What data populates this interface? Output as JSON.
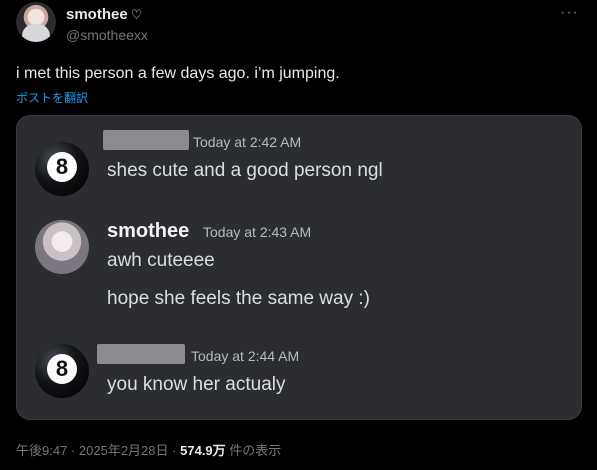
{
  "post": {
    "display_name": "smothee",
    "name_icon": "♡",
    "handle": "@smotheexx",
    "more_icon": "···",
    "text": "i met this person a few days ago. i’m jumping.",
    "translate": "ポストを翻訳"
  },
  "embed": {
    "messages": [
      {
        "author": "",
        "time": "Today at 2:42 AM",
        "lines": [
          "shes cute and a good person ngl"
        ]
      },
      {
        "author": "smothee",
        "time": "Today at 2:43 AM",
        "lines": [
          "awh cuteeee",
          "hope she feels the same way :)"
        ]
      },
      {
        "author": "",
        "time": "Today at 2:44 AM",
        "lines": [
          "you know her actualy"
        ]
      }
    ],
    "ball_label": "8"
  },
  "footer": {
    "time": "午後9:47",
    "sep1": "·",
    "date": "2025年2月28日",
    "sep2": "·",
    "views": "574.9万",
    "views_label": "件の表示"
  }
}
